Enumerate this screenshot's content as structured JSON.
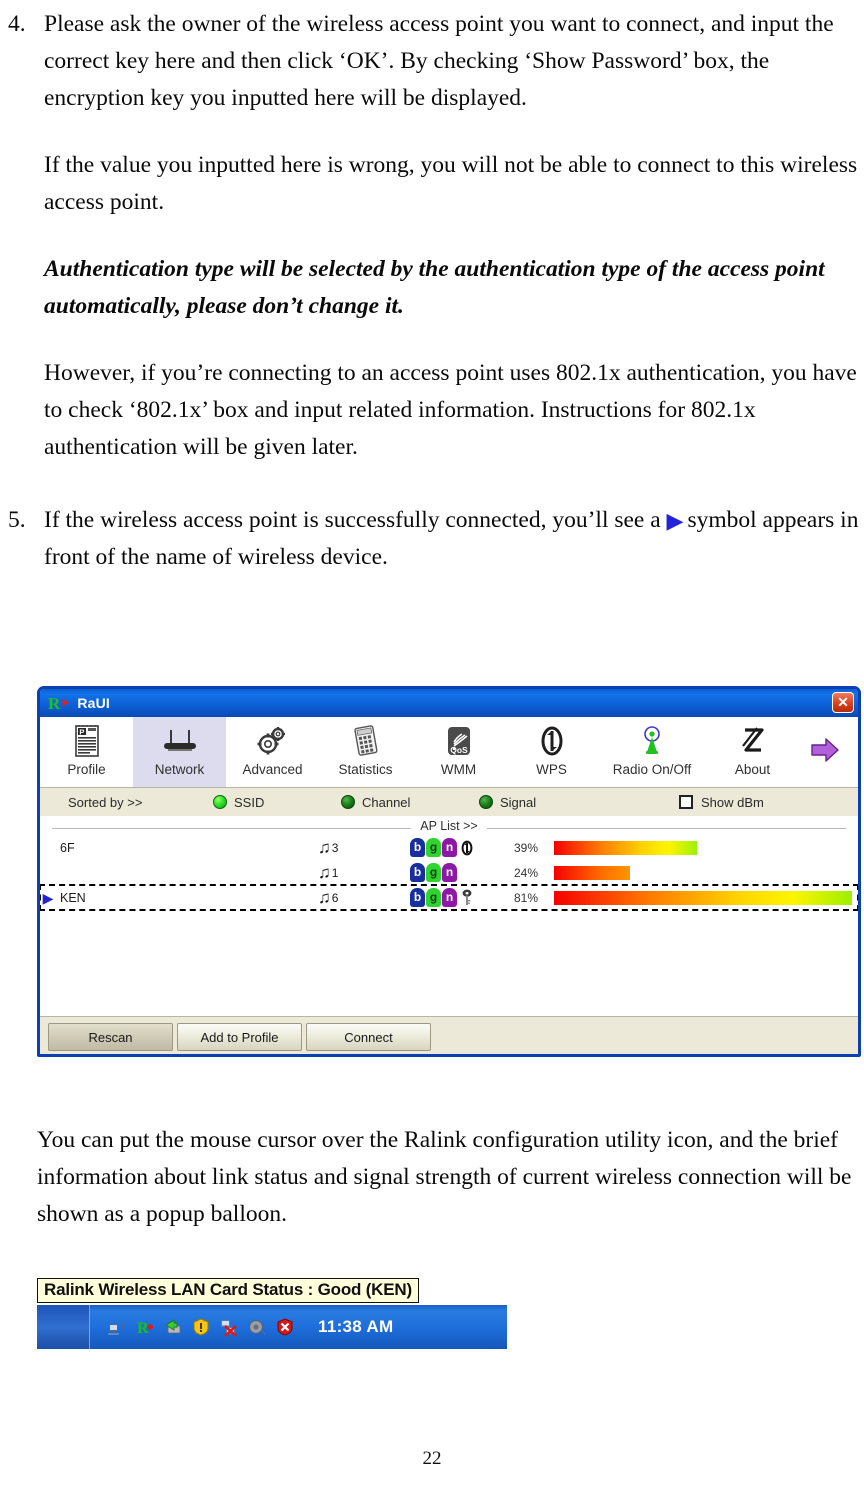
{
  "document": {
    "step4": {
      "number": "4.",
      "p1": "Please ask the owner of the wireless access point you want to connect, and input the correct key here and then click ‘OK’. By checking ‘Show Password’ box, the encryption key you inputted here will be displayed.",
      "p2": "If the value you inputted here is wrong, you will not be able to connect to this wireless access point.",
      "p3_bold": "Authentication type will be selected by the authentication type of the access point automatically, please don’t change it.",
      "p4": "However, if you’re connecting to an access point uses 802.1x authentication, you have to check ‘802.1x’ box and input related information. Instructions for 802.1x authentication will be given later."
    },
    "step5": {
      "number": "5.",
      "text_before_icon": "If the wireless access point is successfully connected, you’ll see a ",
      "icon": "▶",
      "text_after_icon": "symbol appears in front of the name of wireless device."
    },
    "tray_paragraph": "You can put the mouse cursor over the Ralink configuration utility icon, and the brief information about link status and signal strength of current wireless connection will be shown as a popup balloon.",
    "page_number": "22"
  },
  "raui": {
    "window_title": "RaUI",
    "logo_letter": "R",
    "close_label": "✕",
    "toolbar": {
      "items": [
        {
          "label": "Profile",
          "icon": "profile-document-icon",
          "selected": false
        },
        {
          "label": "Network",
          "icon": "router-icon",
          "selected": true
        },
        {
          "label": "Advanced",
          "icon": "gears-icon",
          "selected": false
        },
        {
          "label": "Statistics",
          "icon": "calculator-icon",
          "selected": false
        },
        {
          "label": "WMM",
          "icon": "qos-signal-icon",
          "selected": false
        },
        {
          "label": "WPS",
          "icon": "wps-circle-arrows-icon",
          "selected": false
        },
        {
          "label": "Radio On/Off",
          "icon": "antenna-icon",
          "selected": false
        },
        {
          "label": "About",
          "icon": "ralink-z-icon",
          "selected": false
        }
      ],
      "expand_arrow_icon": "purple-right-arrow-icon"
    },
    "sortbar": {
      "sorted_by_label": "Sorted by >>",
      "options": [
        {
          "label": "SSID",
          "state": "on"
        },
        {
          "label": "Channel",
          "state": "off"
        },
        {
          "label": "Signal",
          "state": "off"
        }
      ],
      "show_dbm_label": "Show dBm",
      "show_dbm_checked": false
    },
    "ap_list": {
      "header": "AP List >>",
      "rows": [
        {
          "connected": false,
          "ssid": "6F",
          "channel": "3",
          "badges": [
            "b",
            "g",
            "n"
          ],
          "extra_icon": "wps-icon",
          "signal_pct": "39%",
          "signal_value": 39
        },
        {
          "connected": false,
          "ssid": "",
          "channel": "1",
          "badges": [
            "b",
            "g",
            "n"
          ],
          "extra_icon": "",
          "signal_pct": "24%",
          "signal_value": 24
        },
        {
          "connected": true,
          "ssid": "KEN",
          "channel": "6",
          "badges": [
            "b",
            "g",
            "n"
          ],
          "extra_icon": "key-icon",
          "signal_pct": "81%",
          "signal_value": 81
        }
      ]
    },
    "buttons": {
      "rescan": "Rescan",
      "add_to_profile": "Add to Profile",
      "connect": "Connect",
      "resize_icon": "▼"
    }
  },
  "tray": {
    "tooltip": "Ralink Wireless LAN Card Status : Good (KEN)",
    "icons": [
      {
        "name": "wireless-network-icon",
        "glyph": "📶"
      },
      {
        "name": "ralink-r-icon",
        "glyph": "R"
      },
      {
        "name": "safely-remove-icon",
        "glyph": "⬅"
      },
      {
        "name": "warning-shield-icon",
        "glyph": "!"
      },
      {
        "name": "network-disconnected-icon",
        "glyph": "✕"
      },
      {
        "name": "volume-icon",
        "glyph": "🔊"
      },
      {
        "name": "security-alert-icon",
        "glyph": "✕"
      }
    ],
    "clock": "11:38 AM"
  },
  "colors": {
    "titlebar_blue": "#1372e8",
    "window_border": "#0c3fb0",
    "selected_tab": "#dcdcee",
    "panel_beige": "#ece9d8",
    "connected_arrow": "#2222cc",
    "tooltip_bg": "#ffffdc",
    "signal_gradient_start": "#f60000",
    "signal_gradient_end": "#9cf000"
  }
}
